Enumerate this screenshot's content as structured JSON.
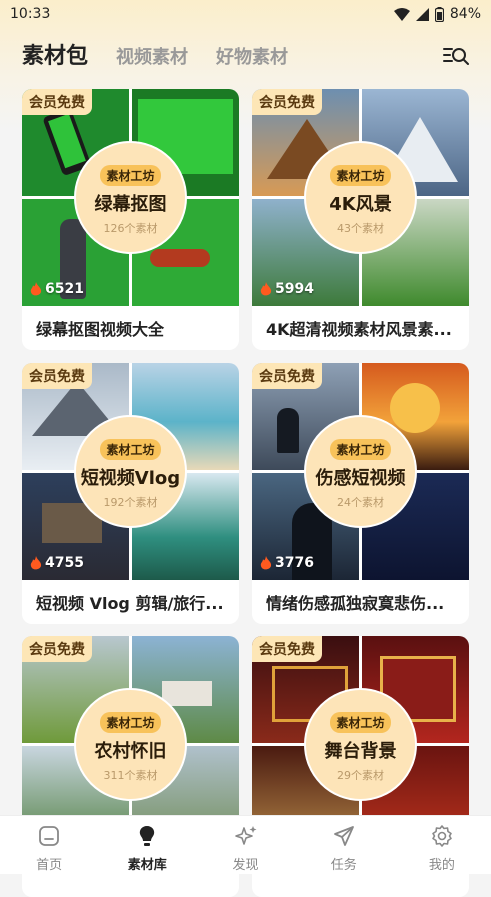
{
  "status": {
    "time": "10:33",
    "battery": "84%"
  },
  "tabs": [
    {
      "label": "素材包"
    },
    {
      "label": "视频素材"
    },
    {
      "label": "好物素材"
    }
  ],
  "colors": {
    "accent": "#f8c25a",
    "badge_bg": "#fde6b6",
    "circle_bg": "#fde4b8"
  },
  "cards": [
    {
      "badge": "会员免费",
      "tag": "素材工坊",
      "name": "绿幕抠图",
      "count": "126个素材",
      "hot": "6521",
      "title": "绿幕抠图视频大全"
    },
    {
      "badge": "会员免费",
      "tag": "素材工坊",
      "name": "4K风景",
      "count": "43个素材",
      "hot": "5994",
      "title": "4K超清视频素材风景素..."
    },
    {
      "badge": "会员免费",
      "tag": "素材工坊",
      "name": "短视频Vlog",
      "count": "192个素材",
      "hot": "4755",
      "title": "短视频 Vlog 剪辑/旅行..."
    },
    {
      "badge": "会员免费",
      "tag": "素材工坊",
      "name": "伤感短视频",
      "count": "24个素材",
      "hot": "3776",
      "title": "情绪伤感孤独寂寞悲伤..."
    },
    {
      "badge": "会员免费",
      "tag": "素材工坊",
      "name": "农村怀旧",
      "count": "311个素材"
    },
    {
      "badge": "会员免费",
      "tag": "素材工坊",
      "name": "舞台背景",
      "count": "29个素材"
    }
  ],
  "nav": [
    {
      "label": "首页",
      "icon": "home-icon"
    },
    {
      "label": "素材库",
      "icon": "bulb-icon"
    },
    {
      "label": "发现",
      "icon": "sparkle-icon"
    },
    {
      "label": "任务",
      "icon": "send-icon"
    },
    {
      "label": "我的",
      "icon": "gear-icon"
    }
  ]
}
